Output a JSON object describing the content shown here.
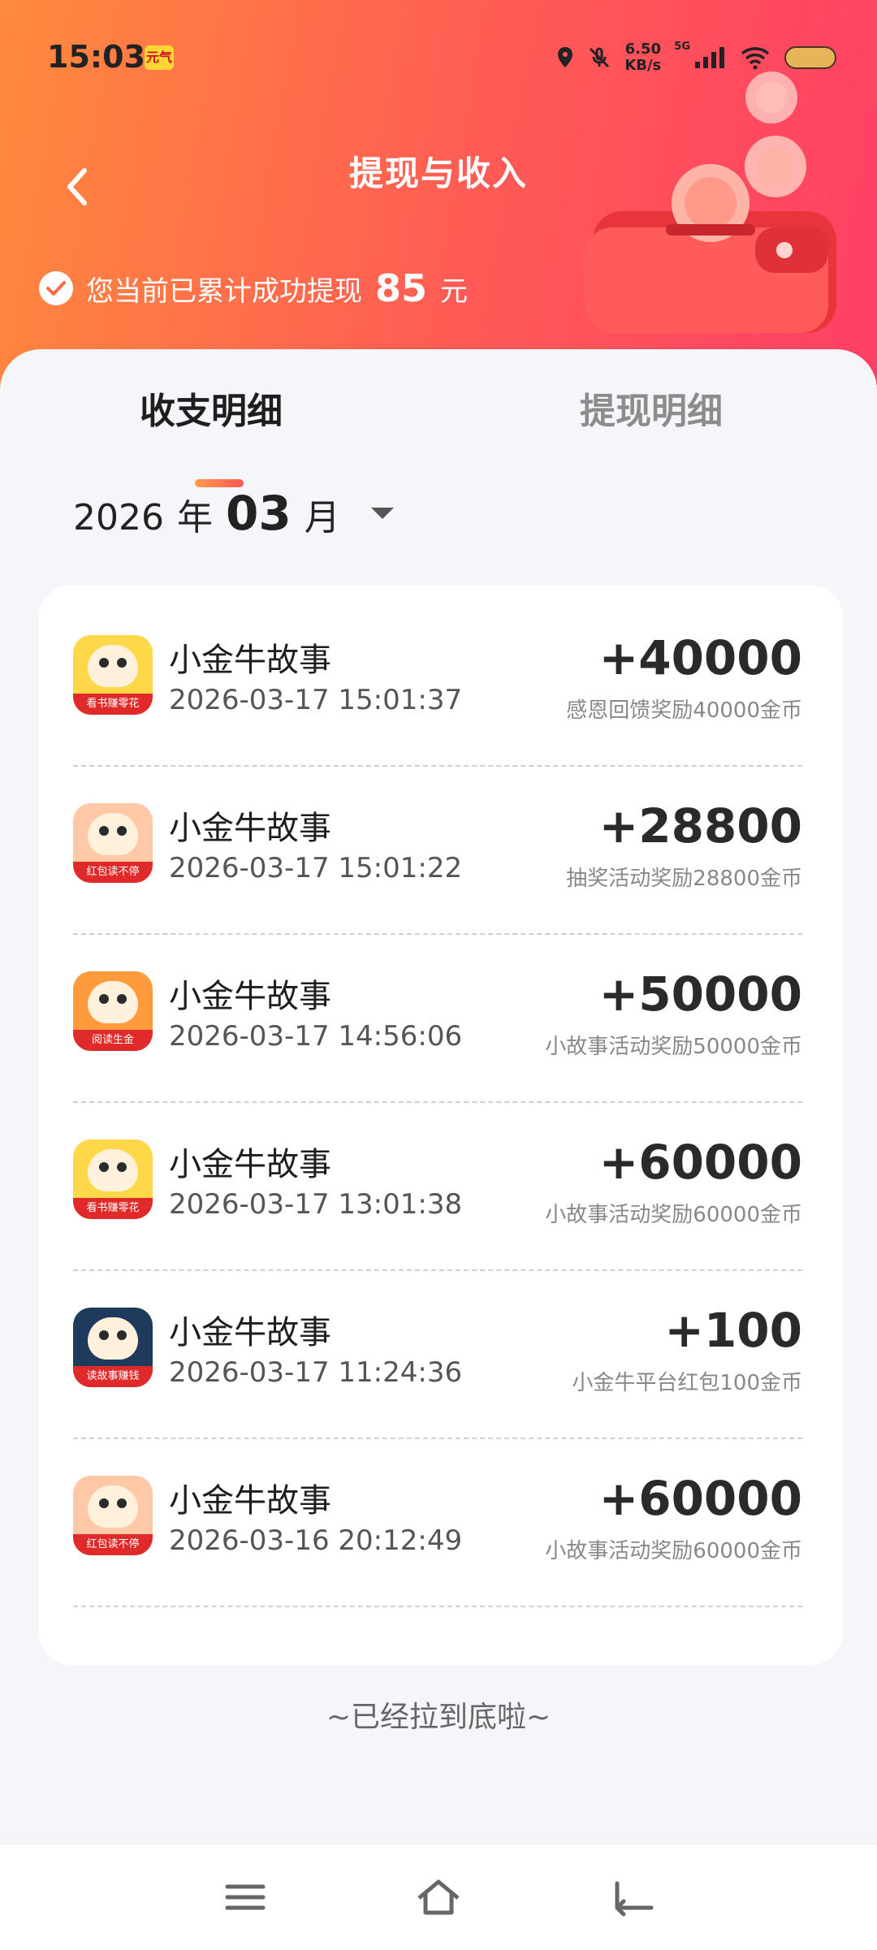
{
  "status_bar": {
    "time": "15:03",
    "app_icon_text": "元气",
    "speed_value": "6.50",
    "speed_unit": "KB/s",
    "network": "5G",
    "icons": [
      "location-icon",
      "mute-icon",
      "signal-icon",
      "wifi-icon",
      "battery-icon"
    ]
  },
  "header": {
    "title": "提现与收入",
    "summary_text": "您当前已累计成功提现",
    "summary_amount": "85",
    "summary_unit": "元"
  },
  "tabs": [
    {
      "label": "收支明细",
      "active": true
    },
    {
      "label": "提现明细",
      "active": false
    }
  ],
  "month_picker": {
    "year": "2026",
    "year_unit": "年",
    "month": "03",
    "month_unit": "月"
  },
  "records": [
    {
      "name": "小金牛故事",
      "time": "2026-03-17 15:01:37",
      "amount": "+40000",
      "desc": "感恩回馈奖励40000金币",
      "icon_tag": "看书赚零花",
      "icon_bg": "#ffd84a"
    },
    {
      "name": "小金牛故事",
      "time": "2026-03-17 15:01:22",
      "amount": "+28800",
      "desc": "抽奖活动奖励28800金币",
      "icon_tag": "红包读不停",
      "icon_bg": "#ffc9a8"
    },
    {
      "name": "小金牛故事",
      "time": "2026-03-17 14:56:06",
      "amount": "+50000",
      "desc": "小故事活动奖励50000金币",
      "icon_tag": "阅读生金",
      "icon_bg": "#ff9b3d"
    },
    {
      "name": "小金牛故事",
      "time": "2026-03-17 13:01:38",
      "amount": "+60000",
      "desc": "小故事活动奖励60000金币",
      "icon_tag": "看书赚零花",
      "icon_bg": "#ffd84a"
    },
    {
      "name": "小金牛故事",
      "time": "2026-03-17 11:24:36",
      "amount": "+100",
      "desc": "小金牛平台红包100金币",
      "icon_tag": "读故事赚钱",
      "icon_bg": "#1f3b5c"
    },
    {
      "name": "小金牛故事",
      "time": "2026-03-16 20:12:49",
      "amount": "+60000",
      "desc": "小故事活动奖励60000金币",
      "icon_tag": "红包读不停",
      "icon_bg": "#ffc9a8"
    }
  ],
  "end_text": "~已经拉到底啦~",
  "colors": {
    "header_start": "#ff8a3d",
    "header_end": "#ff3f66",
    "accent": "#ff5a55"
  }
}
